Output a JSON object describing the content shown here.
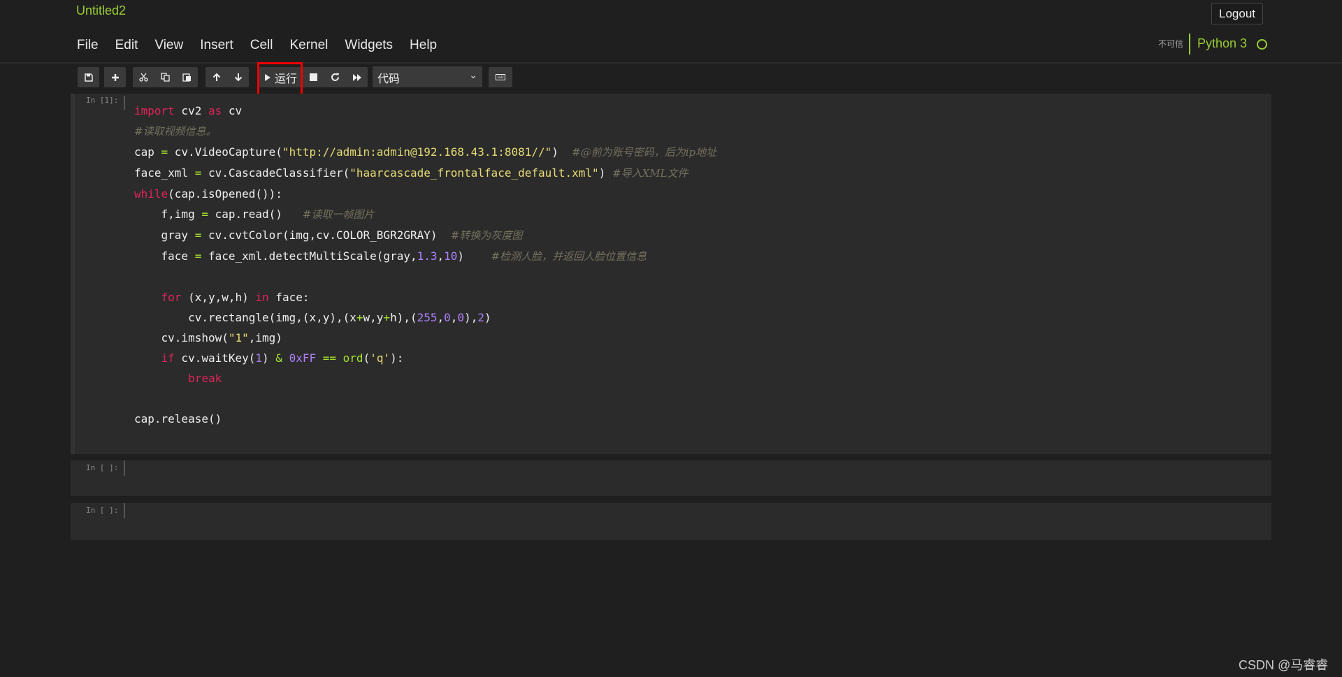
{
  "header": {
    "notebook_name": "Untitled2",
    "logout_label": "Logout",
    "trusted_label": "不可信",
    "kernel_name": "Python 3"
  },
  "menu": [
    "File",
    "Edit",
    "View",
    "Insert",
    "Cell",
    "Kernel",
    "Widgets",
    "Help"
  ],
  "toolbar": {
    "run_label": "运行",
    "cell_type": "代码",
    "icons": [
      "save-icon",
      "plus-icon",
      "cut-icon",
      "copy-icon",
      "paste-icon",
      "arrow-up-icon",
      "arrow-down-icon",
      "play-icon",
      "stop-icon",
      "restart-icon",
      "fast-forward-icon",
      "keyboard-icon"
    ]
  },
  "cells": [
    {
      "prompt": "In [1]:",
      "lines": [
        "import cv2 as cv",
        "#读取视频信息。",
        "cap = cv.VideoCapture(\"http://admin:admin@192.168.43.1:8081//\")  #@前为账号密码，后为ip地址",
        "face_xml = cv.CascadeClassifier(\"haarcascade_frontalface_default.xml\") #导入XML文件",
        "while(cap.isOpened()):",
        "    f,img = cap.read()   #读取一帧图片",
        "    gray = cv.cvtColor(img,cv.COLOR_BGR2GRAY)  #转换为灰度图",
        "    face = face_xml.detectMultiScale(gray,1.3,10)    #检测人脸，并返回人脸位置信息",
        "",
        "    for (x,y,w,h) in face:",
        "        cv.rectangle(img,(x,y),(x+w,y+h),(255,0,0),2)",
        "    cv.imshow(\"1\",img)",
        "    if cv.waitKey(1) & 0xFF == ord('q'):",
        "        break",
        "",
        "cap.release()"
      ]
    },
    {
      "prompt": "In [ ]:"
    },
    {
      "prompt": "In [ ]:"
    }
  ],
  "watermark": "CSDN @马睿睿",
  "colors": {
    "accent": "#9acd32",
    "keyword": "#e0235a",
    "string": "#e6db74",
    "number": "#ae81ff",
    "comment": "#75715e",
    "highlight": "#ff0000"
  }
}
